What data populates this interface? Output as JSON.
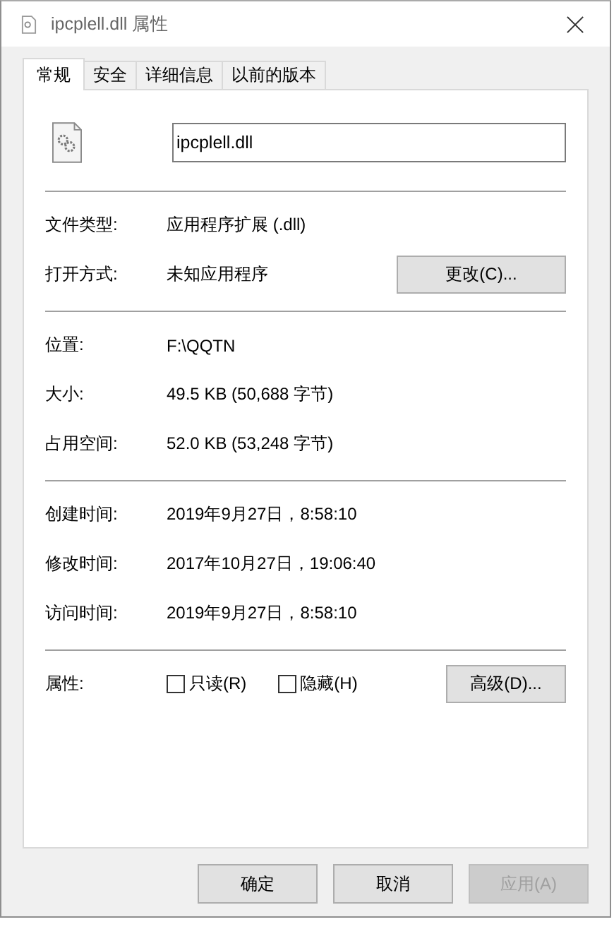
{
  "window": {
    "title": "ipcplell.dll 属性"
  },
  "tabs": [
    {
      "label": "常规",
      "selected": true
    },
    {
      "label": "安全",
      "selected": false
    },
    {
      "label": "详细信息",
      "selected": false
    },
    {
      "label": "以前的版本",
      "selected": false
    }
  ],
  "file": {
    "name": "ipcplell.dll"
  },
  "sections": [
    {
      "rows": [
        {
          "label": "文件类型:",
          "value": "应用程序扩展 (.dll)"
        },
        {
          "label": "打开方式:",
          "value": "未知应用程序",
          "button": "更改(C)..."
        }
      ]
    },
    {
      "rows": [
        {
          "label": "位置:",
          "value": "F:\\QQTN"
        },
        {
          "label": "大小:",
          "value": "49.5 KB (50,688 字节)"
        },
        {
          "label": "占用空间:",
          "value": "52.0 KB (53,248 字节)"
        }
      ]
    },
    {
      "rows": [
        {
          "label": "创建时间:",
          "value": "2019年9月27日，8:58:10"
        },
        {
          "label": "修改时间:",
          "value": "2017年10月27日，19:06:40"
        },
        {
          "label": "访问时间:",
          "value": "2019年9月27日，8:58:10"
        }
      ]
    }
  ],
  "attributes": {
    "label": "属性:",
    "checkboxes": [
      {
        "label": "只读(R)",
        "checked": false
      },
      {
        "label": "隐藏(H)",
        "checked": false
      }
    ],
    "button": "高级(D)..."
  },
  "buttons": [
    {
      "label": "确定",
      "disabled": false
    },
    {
      "label": "取消",
      "disabled": false
    },
    {
      "label": "应用(A)",
      "disabled": true
    }
  ]
}
